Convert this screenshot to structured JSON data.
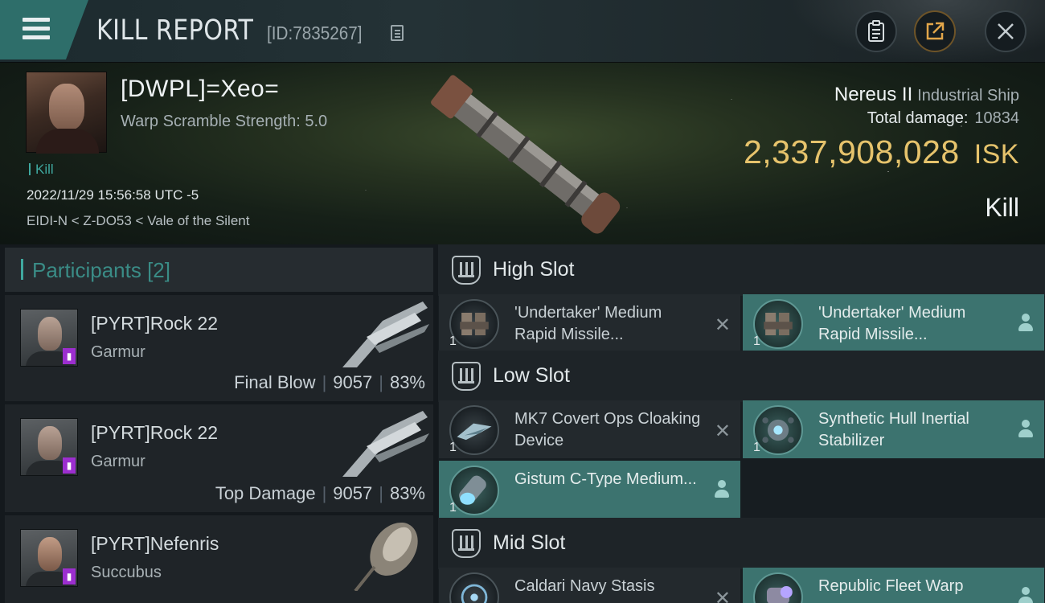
{
  "header": {
    "title": "KILL REPORT",
    "id_label": "[ID:7835267]",
    "buttons": [
      "clipboard-icon",
      "share-icon",
      "close-icon"
    ]
  },
  "victim": {
    "name": "[DWPL]=Xeo=",
    "warp_scramble": "Warp Scramble Strength: 5.0",
    "tag": "Kill",
    "datetime": "2022/11/29 15:56:58 UTC -5",
    "location": "EIDI-N < Z-DO53 < Vale of the Silent",
    "ship": "Nereus II",
    "ship_class": "Industrial Ship",
    "total_damage_label": "Total damage:",
    "total_damage": "10834",
    "isk_value": "2,337,908,028",
    "isk_unit": "ISK",
    "result": "Kill"
  },
  "participants": {
    "label": "Participants",
    "count": "[2]",
    "items": [
      {
        "name": "[PYRT]Rock 22",
        "ship": "Garmur",
        "role": "Final Blow",
        "damage": "9057",
        "percent": "83%"
      },
      {
        "name": "[PYRT]Rock 22",
        "ship": "Garmur",
        "role": "Top Damage",
        "damage": "9057",
        "percent": "83%"
      },
      {
        "name": "[PYRT]Nefenris",
        "ship": "Succubus",
        "role": "",
        "damage": "",
        "percent": ""
      }
    ]
  },
  "slots": {
    "high": {
      "title": "High Slot",
      "modules": [
        {
          "name": "'Undertaker' Medium Rapid Missile...",
          "qty": "1",
          "state": "destroyed"
        },
        {
          "name": "'Undertaker' Medium Rapid Missile...",
          "qty": "1",
          "state": "dropped"
        }
      ]
    },
    "low": {
      "title": "Low Slot",
      "modules": [
        {
          "name": "MK7 Covert Ops Cloaking Device",
          "qty": "1",
          "state": "destroyed"
        },
        {
          "name": "Synthetic Hull Inertial Stabilizer",
          "qty": "1",
          "state": "dropped"
        },
        {
          "name": "Gistum C-Type Medium...",
          "qty": "1",
          "state": "dropped"
        }
      ]
    },
    "mid": {
      "title": "Mid Slot",
      "modules": [
        {
          "name": "Caldari Navy Stasis",
          "qty": "1",
          "state": "destroyed"
        },
        {
          "name": "Republic Fleet Warp",
          "qty": "1",
          "state": "dropped"
        }
      ]
    }
  },
  "colors": {
    "accent": "#3fa89f",
    "isk_gold": "#e6c36c",
    "dropped_bg": "#3c736f",
    "destroyed_bg": "#23292d"
  }
}
